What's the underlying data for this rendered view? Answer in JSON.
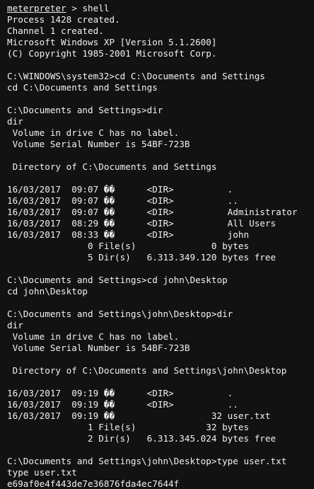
{
  "session": {
    "prompt": "meterpreter",
    "prompt_suffix": " > ",
    "command": "shell"
  },
  "terminal": {
    "lines": [
      "Process 1428 created.",
      "Channel 1 created.",
      "Microsoft Windows XP [Version 5.1.2600]",
      "(C) Copyright 1985-2001 Microsoft Corp.",
      "",
      "C:\\WINDOWS\\system32>cd C:\\Documents and Settings",
      "cd C:\\Documents and Settings",
      "",
      "C:\\Documents and Settings>dir",
      "dir",
      " Volume in drive C has no label.",
      " Volume Serial Number is 54BF-723B",
      "",
      " Directory of C:\\Documents and Settings",
      "",
      "16/03/2017  09:07 ��      <DIR>          .",
      "16/03/2017  09:07 ��      <DIR>          ..",
      "16/03/2017  09:07 ��      <DIR>          Administrator",
      "16/03/2017  08:29 ��      <DIR>          All Users",
      "16/03/2017  08:33 ��      <DIR>          john",
      "               0 File(s)              0 bytes",
      "               5 Dir(s)   6.313.349.120 bytes free",
      "",
      "C:\\Documents and Settings>cd john\\Desktop",
      "cd john\\Desktop",
      "",
      "C:\\Documents and Settings\\john\\Desktop>dir",
      "dir",
      " Volume in drive C has no label.",
      " Volume Serial Number is 54BF-723B",
      "",
      " Directory of C:\\Documents and Settings\\john\\Desktop",
      "",
      "16/03/2017  09:19 ��      <DIR>          .",
      "16/03/2017  09:19 ��      <DIR>          ..",
      "16/03/2017  09:19 ��                  32 user.txt",
      "               1 File(s)             32 bytes",
      "               2 Dir(s)   6.313.345.024 bytes free",
      "",
      "C:\\Documents and Settings\\john\\Desktop>type user.txt",
      "type user.txt",
      "e69af0e4f443de7e36876fda4ec7644f"
    ]
  },
  "colors": {
    "background": "#121212",
    "text": "#f2f2f2"
  }
}
